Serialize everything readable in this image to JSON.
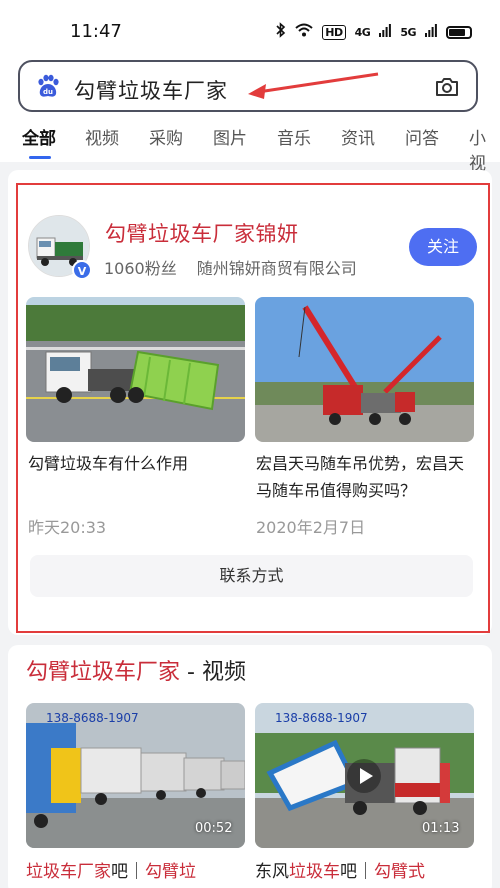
{
  "status_bar": {
    "time": "11:47",
    "signal_1": "4G",
    "signal_2": "5G",
    "hd_label": "HD"
  },
  "search": {
    "query": "勾臂垃圾车厂家",
    "logo_text": "du"
  },
  "tabs": [
    "全部",
    "视频",
    "采购",
    "图片",
    "音乐",
    "资讯",
    "问答",
    "小视"
  ],
  "active_tab": "全部",
  "account": {
    "name": "勾臂垃圾车厂家锦妍",
    "fans": "1060粉丝",
    "company": "随州锦妍商贸有限公司",
    "follow_label": "关注",
    "verified_badge": "V"
  },
  "items": [
    {
      "title": "勾臂垃圾车有什么作用",
      "date": "昨天20:33"
    },
    {
      "title": "宏昌天马随车吊优势，宏昌天马随车吊值得购买吗？",
      "date": "2020年2月7日"
    }
  ],
  "contact_label": "联系方式",
  "video_section": {
    "heading_highlight": "勾臂垃圾车厂家",
    "heading_rest": " - 视频",
    "videos": [
      {
        "duration": "00:52",
        "overlay_phone": "138-8688-1907",
        "cap_hl1": "垃圾车厂家",
        "cap_mid": "吧｜",
        "cap_hl2": "勾臂垃"
      },
      {
        "duration": "01:13",
        "overlay_phone": "138-8688-1907",
        "cap_pre": "东风",
        "cap_hl1": "垃圾车",
        "cap_mid": "吧｜",
        "cap_hl2": "勾臂式"
      }
    ]
  },
  "colors": {
    "highlight_red": "#c92d3a",
    "brand_blue": "#4e6ef2",
    "annotation_red": "#e23c3c"
  }
}
